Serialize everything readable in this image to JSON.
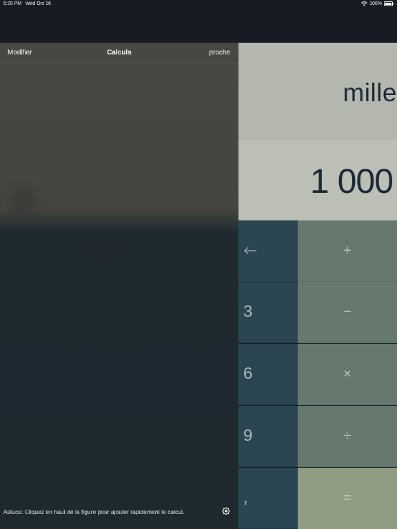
{
  "status_bar": {
    "time": "5:29 PM",
    "date": "Wed Oct 16",
    "battery": "100%"
  },
  "display": {
    "words": "mille",
    "number": "1 000"
  },
  "keys": {
    "backspace": "←",
    "plus": "+",
    "three": "3",
    "minus": "−",
    "six": "6",
    "times": "×",
    "nine": "9",
    "divide": "÷",
    "decimal": ",",
    "equals": "="
  },
  "history_panel": {
    "edit_label": "Modifier",
    "title": "Calculs",
    "close_label": "proche",
    "tip": "Astuce: Cliquez en haut de la figure pour ajouter rapidement le calcul."
  },
  "colors": {
    "digit_key": "#2b4551",
    "operator_key": "#67796e",
    "equals_key": "#909b84",
    "display_bg": "#b3b7ae",
    "panel_bg": "#1d282f"
  }
}
